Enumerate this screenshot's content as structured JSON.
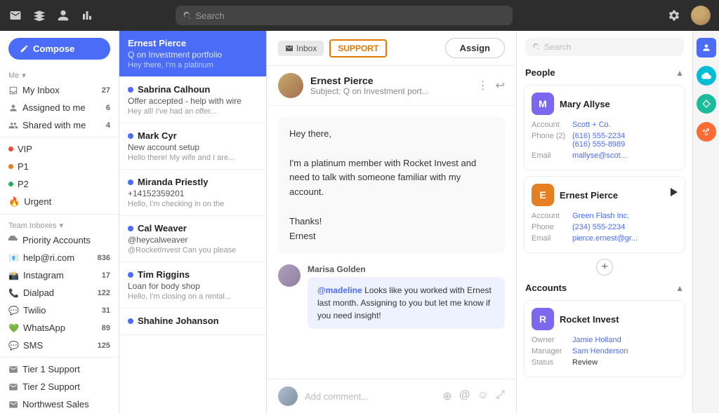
{
  "topNav": {
    "searchPlaceholder": "Search",
    "icons": [
      "mail",
      "layers",
      "person",
      "bar-chart"
    ]
  },
  "sidebar": {
    "composeLabel": "Compose",
    "meSection": "Me",
    "myInbox": "My Inbox",
    "myInboxCount": "27",
    "assignedToMe": "Assigned to me",
    "assignedCount": "6",
    "sharedWithMe": "Shared with me",
    "sharedCount": "4",
    "labels": [
      "VIP",
      "P1",
      "P2",
      "Urgent"
    ],
    "teamInboxes": "Team Inboxes",
    "priorityAccounts": "Priority Accounts",
    "inboxes": [
      {
        "name": "help@ri.com",
        "count": "836"
      },
      {
        "name": "Instagram",
        "count": "17"
      },
      {
        "name": "Dialpad",
        "count": "122"
      },
      {
        "name": "Twilio",
        "count": "31"
      },
      {
        "name": "WhatsApp",
        "count": "89"
      },
      {
        "name": "SMS",
        "count": "125"
      }
    ],
    "tier1": "Tier 1 Support",
    "tier2": "Tier 2 Support",
    "northwest": "Northwest Sales"
  },
  "conversations": [
    {
      "name": "Ernest Pierce",
      "subject": "Q on Investment portfolio",
      "preview": "Hey there, I'm a platinum",
      "active": true,
      "unread": false
    },
    {
      "name": "Sabrina Calhoun",
      "subject": "Offer accepted - help with wire",
      "preview": "Hey all! I've had an offer...",
      "active": false,
      "unread": true
    },
    {
      "name": "Mark Cyr",
      "subject": "New account setup",
      "preview": "Hello there! My wife and I are...",
      "active": false,
      "unread": true
    },
    {
      "name": "Miranda Priestly",
      "subject": "+14152359201",
      "preview": "Hello, I'm checking in on the",
      "active": false,
      "unread": true
    },
    {
      "name": "Cal Weaver",
      "subject": "@heycalweaver",
      "preview": "@RocketInvest Can you please",
      "active": false,
      "unread": true
    },
    {
      "name": "Tim Riggins",
      "subject": "Loan for body shop",
      "preview": "Hello, I'm closing on a rental...",
      "active": false,
      "unread": true
    },
    {
      "name": "Shahine Johanson",
      "subject": "",
      "preview": "",
      "active": false,
      "unread": true
    }
  ],
  "messageHeader": {
    "inboxLabel": "Inbox",
    "supportLabel": "SUPPORT",
    "assignLabel": "Assign"
  },
  "messageView": {
    "senderName": "Ernest Pierce",
    "senderSubject": "Subject: Q on Investment port...",
    "body": "Hey there,\n\nI'm a platinum member with Rocket Invest and need to talk with someone familiar with my account.\n\nThanks!\nErnest",
    "commentAuthor": "Marisa Golden",
    "commentText": "@madeline Looks like you worked with Ernest last month. Assigning to you but let me know if you need insight!",
    "mention": "@madeline",
    "commentPlaceholder": "Add comment..."
  },
  "rightPanel": {
    "searchPlaceholder": "Search",
    "peopleHeader": "People",
    "accountsHeader": "Accounts",
    "contacts": [
      {
        "name": "Mary Allyse",
        "avatarColor": "#7b68ee",
        "avatarText": "M",
        "account": "Scott + Co.",
        "phone": "(616) 555-2234",
        "phone2": "(616) 555-8989",
        "email": "mallyse@scot..."
      },
      {
        "name": "Ernest Pierce",
        "avatarColor": "#e67e22",
        "avatarText": "E",
        "account": "Green Flash Inc.",
        "phone": "(234) 555-2234",
        "email": "pierce.ernest@gr..."
      }
    ],
    "accounts": [
      {
        "name": "Rocket Invest",
        "avatarColor": "#7b68ee",
        "avatarText": "R",
        "owner": "Jamie Holland",
        "manager": "Sam Henderson",
        "status": "Review"
      }
    ]
  }
}
